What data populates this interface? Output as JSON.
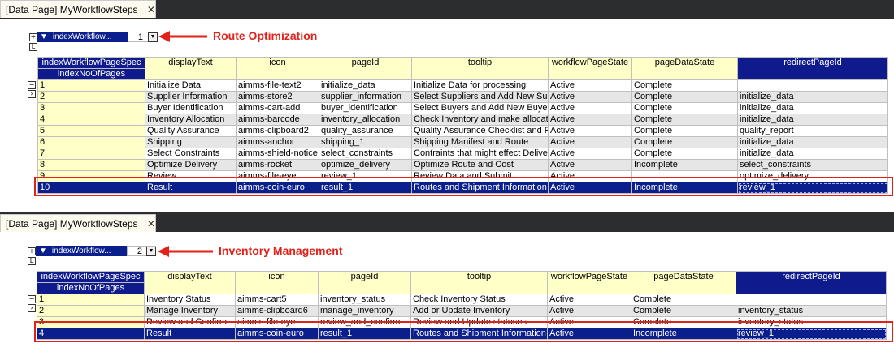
{
  "panels": [
    {
      "tab_title": "[Data Page] MyWorkflowSteps",
      "close_glyph": "✕",
      "filter_label": "indexWorkflow...",
      "filter_value": "1",
      "annotation": "Route Optimization",
      "index_header_1": "indexWorkflowPageSpec",
      "index_header_2": "indexNoOfPages",
      "columns": [
        "displayText",
        "icon",
        "pageId",
        "tooltip",
        "workflowPageState",
        "pageDataState",
        "redirectPageId"
      ],
      "rows": [
        [
          "1",
          "Initialize Data",
          "aimms-file-text2",
          "initialize_data",
          "Initialize Data for processing",
          "Active",
          "Complete",
          ""
        ],
        [
          "2",
          "Supplier Information",
          "aimms-store2",
          "supplier_information",
          "Select Suppliers and Add New Sup",
          "Active",
          "Complete",
          "initialize_data"
        ],
        [
          "3",
          "Buyer Identification",
          "aimms-cart-add",
          "buyer_identification",
          "Select Buyers and Add New Buye",
          "Active",
          "Complete",
          "initialize_data"
        ],
        [
          "4",
          "Inventory Allocation",
          "aimms-barcode",
          "inventory_allocation",
          "Check Inventory and make allocati",
          "Active",
          "Complete",
          "initialize_data"
        ],
        [
          "5",
          "Quality Assurance",
          "aimms-clipboard2",
          "quality_assurance",
          "Quality Assurance Checklist and P",
          "Active",
          "Complete",
          "quality_report"
        ],
        [
          "6",
          "Shipping",
          "aimms-anchor",
          "shipping_1",
          "Shipping Manifest and Route",
          "Active",
          "Complete",
          "initialize_data"
        ],
        [
          "7",
          "Select Constraints",
          "aimms-shield-notice",
          "select_constraints",
          "Contraints that might effect Deliver",
          "Active",
          "Complete",
          "initialize_data"
        ],
        [
          "8",
          "Optimize Delivery",
          "aimms-rocket",
          "optimize_delivery",
          "Optimize Route and Cost",
          "Active",
          "Incomplete",
          "select_constraints"
        ],
        [
          "9",
          "Review",
          "aimms-file-eye",
          "review_1",
          "Review Data and Submit",
          "Active",
          "",
          "optimize_delivery"
        ],
        [
          "10",
          "Result",
          "aimms-coin-euro",
          "result_1",
          "Routes and Shipment Information",
          "Active",
          "Incomplete",
          "review_1"
        ]
      ]
    },
    {
      "tab_title": "[Data Page] MyWorkflowSteps",
      "close_glyph": "✕",
      "filter_label": "indexWorkflow...",
      "filter_value": "2",
      "annotation": "Inventory Management",
      "index_header_1": "indexWorkflowPageSpec",
      "index_header_2": "indexNoOfPages",
      "columns": [
        "displayText",
        "icon",
        "pageId",
        "tooltip",
        "workflowPageState",
        "pageDataState",
        "redirectPageId"
      ],
      "rows": [
        [
          "1",
          "Inventory Status",
          "aimms-cart5",
          "inventory_status",
          "Check Inventory Status",
          "Active",
          "Complete",
          ""
        ],
        [
          "2",
          "Manage Inventory",
          "aimms-clipboard6",
          "manage_inventory",
          "Add or Update Inventory",
          "Active",
          "Complete",
          "inventory_status"
        ],
        [
          "3",
          "Review and Confirm",
          "aimms-file-eye",
          "review_and_confirm",
          "Review and Update statuses",
          "Active",
          "Complete",
          "inventory_status"
        ],
        [
          "4",
          "Result",
          "aimms-coin-euro",
          "result_1",
          "Routes and Shipment Information",
          "Active",
          "Incomplete",
          "review_1"
        ]
      ]
    }
  ],
  "colors": {
    "accent": "#0a1e8c",
    "header": "#ffffc8",
    "annotation": "#e0221a",
    "strip": "#2b2d2f"
  }
}
